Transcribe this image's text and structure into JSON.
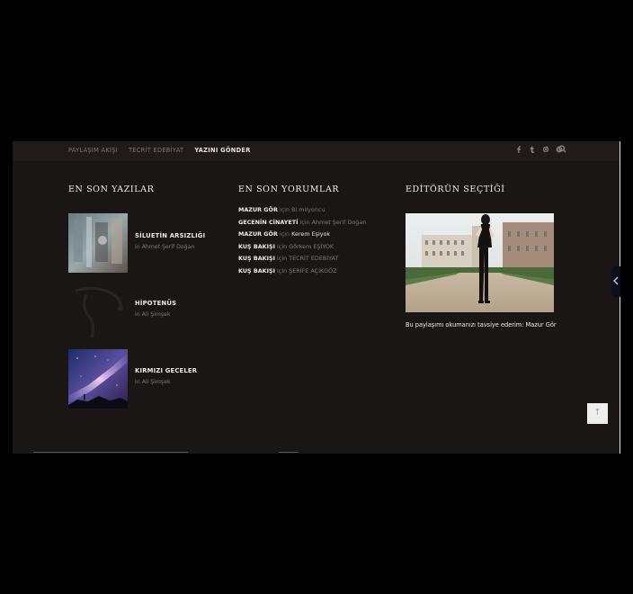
{
  "nav": {
    "items": [
      {
        "label": "PAYLAŞIM AKIŞI",
        "active": false
      },
      {
        "label": "TECRİT EDEBİYAT",
        "active": false
      },
      {
        "label": "YAZINI GÖNDER",
        "active": true
      }
    ]
  },
  "social_icons": [
    "facebook-icon",
    "tumblr-icon",
    "instagram-icon",
    "pinterest-icon"
  ],
  "search_icon": "search-icon",
  "columns": {
    "latest_posts_title": "EN SON YAZILAR",
    "latest_comments_title": "EN SON YORUMLAR",
    "editor_pick_title": "EDİTÖRÜN SEÇTİĞİ"
  },
  "posts": [
    {
      "title": "SİLUETİN ARSIZLIĞI",
      "meta": "in Ahmet Şerif Doğan"
    },
    {
      "title": "HİPOTENÜS",
      "meta": "in Ali Şimşek"
    },
    {
      "title": "KIRMIZI GECELER",
      "meta": "in Ali Şimşek"
    }
  ],
  "comments": [
    {
      "post": "MAZUR GÖR",
      "for": "için",
      "author": "Bi milyoncu",
      "author_white": false
    },
    {
      "post": "GECENİN CİNAYETİ",
      "for": "için",
      "author": "Ahmet Şerif Doğan",
      "author_white": false
    },
    {
      "post": "MAZUR GÖR",
      "for": "için",
      "author": "Kerem Eşiyok",
      "author_white": true
    },
    {
      "post": "KUŞ BAKIŞI",
      "for": "için",
      "author": "Görkem EŞİYOK",
      "author_white": false
    },
    {
      "post": "KUŞ BAKIŞI",
      "for": "için",
      "author": "TECRİT EDEBİYAT",
      "author_white": false
    },
    {
      "post": "KUŞ BAKIŞI",
      "for": "için",
      "author": "ŞERİFE AÇIKGÖZ",
      "author_white": false
    }
  ],
  "editor_pick": {
    "caption": "Bu paylaşımı okumanızı tavsiye ederim: Mazur Gör"
  },
  "to_top": "↑",
  "colors": {
    "panel_bg": "#1b1616",
    "text_primary": "#f0eaea",
    "text_muted": "#7f7878"
  }
}
